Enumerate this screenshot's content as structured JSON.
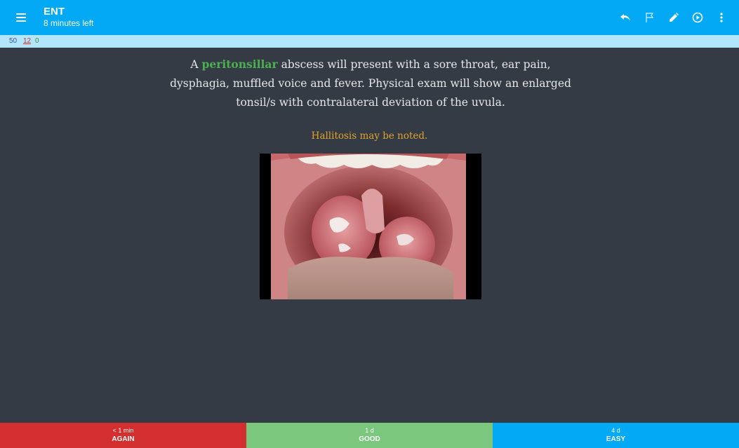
{
  "appbar": {
    "title": "ENT",
    "subtitle": "8 minutes left",
    "icons": [
      "menu-icon",
      "undo-icon",
      "flag-icon",
      "edit-icon",
      "play-icon",
      "more-icon"
    ],
    "color": "#03a9f4"
  },
  "counts": {
    "new": "50",
    "learn": "12",
    "review": "0"
  },
  "card": {
    "text_prefix": "A ",
    "keyword": "peritonsillar",
    "text_body": " abscess will present with a sore throat, ear pain, dysphagia, muffled voice and fever. Physical exam will show an enlarged tonsil/s with contralateral deviation of the uvula.",
    "note": "Hallitosis may be noted.",
    "keyword_color": "#4caf50",
    "note_color": "#e0a22a",
    "background": "#343b45"
  },
  "answers": [
    {
      "interval": "< 1 min",
      "label": "AGAIN",
      "color": "#d32f2f"
    },
    {
      "interval": "1 d",
      "label": "GOOD",
      "color": "#7bc77e"
    },
    {
      "interval": "4 d",
      "label": "EASY",
      "color": "#03a9f4"
    }
  ]
}
